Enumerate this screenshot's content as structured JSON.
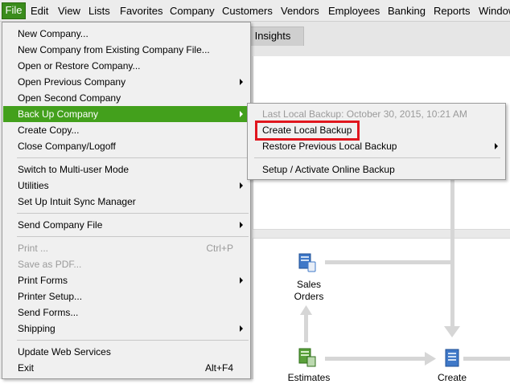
{
  "menubar": {
    "items": [
      "File",
      "Edit",
      "View",
      "Lists",
      "Favorites",
      "Company",
      "Customers",
      "Vendors",
      "Employees",
      "Banking",
      "Reports",
      "Window"
    ]
  },
  "background": {
    "tab_label": "Insights",
    "flow": {
      "sales_orders": "Sales\nOrders",
      "estimates": "Estimates",
      "create": "Create"
    }
  },
  "file_menu": {
    "items": [
      {
        "label": "New Company...",
        "shortcut": "",
        "submenu": false,
        "disabled": false
      },
      {
        "label": "New Company from Existing Company File...",
        "shortcut": "",
        "submenu": false,
        "disabled": false
      },
      {
        "label": "Open or Restore Company...",
        "shortcut": "",
        "submenu": false,
        "disabled": false
      },
      {
        "label": "Open Previous Company",
        "shortcut": "",
        "submenu": true,
        "disabled": false
      },
      {
        "label": "Open Second Company",
        "shortcut": "",
        "submenu": false,
        "disabled": false
      },
      {
        "label": "Back Up Company",
        "shortcut": "",
        "submenu": true,
        "disabled": false,
        "highlighted": true
      },
      {
        "label": "Create Copy...",
        "shortcut": "",
        "submenu": false,
        "disabled": false
      },
      {
        "label": "Close Company/Logoff",
        "shortcut": "",
        "submenu": false,
        "disabled": false
      },
      {
        "label": "Switch to Multi-user Mode",
        "shortcut": "",
        "submenu": false,
        "disabled": false
      },
      {
        "label": "Utilities",
        "shortcut": "",
        "submenu": true,
        "disabled": false
      },
      {
        "label": "Set Up Intuit Sync Manager",
        "shortcut": "",
        "submenu": false,
        "disabled": false
      },
      {
        "label": "Send Company File",
        "shortcut": "",
        "submenu": true,
        "disabled": false
      },
      {
        "label": "Print ...",
        "shortcut": "Ctrl+P",
        "submenu": false,
        "disabled": true
      },
      {
        "label": "Save as PDF...",
        "shortcut": "",
        "submenu": false,
        "disabled": true
      },
      {
        "label": "Print Forms",
        "shortcut": "",
        "submenu": true,
        "disabled": false
      },
      {
        "label": "Printer Setup...",
        "shortcut": "",
        "submenu": false,
        "disabled": false
      },
      {
        "label": "Send Forms...",
        "shortcut": "",
        "submenu": false,
        "disabled": false
      },
      {
        "label": "Shipping",
        "shortcut": "",
        "submenu": true,
        "disabled": false
      },
      {
        "label": "Update Web Services",
        "shortcut": "",
        "submenu": false,
        "disabled": false
      },
      {
        "label": "Exit",
        "shortcut": "Alt+F4",
        "submenu": false,
        "disabled": false
      }
    ]
  },
  "backup_submenu": {
    "items": [
      {
        "label": "Last Local Backup: October 30, 2015, 10:21 AM",
        "disabled": true,
        "submenu": false
      },
      {
        "label": "Create Local Backup",
        "disabled": false,
        "submenu": false,
        "outlined": true
      },
      {
        "label": "Restore Previous Local Backup",
        "disabled": false,
        "submenu": true
      },
      {
        "label": "Setup / Activate Online Backup",
        "disabled": false,
        "submenu": false
      }
    ]
  },
  "colors": {
    "highlight": "#43a01c",
    "outline": "#e0161e"
  }
}
